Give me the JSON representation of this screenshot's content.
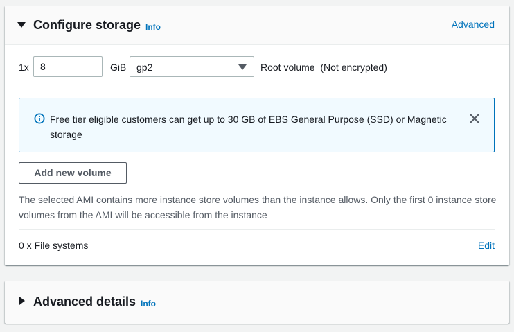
{
  "configure_storage": {
    "title": "Configure storage",
    "info_label": "Info",
    "advanced_link": "Advanced",
    "volume": {
      "count_prefix": "1x",
      "size_value": "8",
      "size_unit": "GiB",
      "volume_type": "gp2",
      "description": "Root volume  (Not encrypted)"
    },
    "alert": {
      "message": "Free tier eligible customers can get up to 30 GB of EBS General Purpose (SSD) or Magnetic storage",
      "icon": "info-circle-icon",
      "close_icon": "close-icon"
    },
    "add_volume_button": "Add new volume",
    "instance_store_warning": "The selected AMI contains more instance store volumes than the instance allows. Only the first 0 instance store volumes from the AMI will be accessible from the instance",
    "file_systems_label": "0 x File systems",
    "edit_link": "Edit"
  },
  "advanced_details": {
    "title": "Advanced details",
    "info_label": "Info"
  },
  "colors": {
    "link": "#0073bb",
    "alert_border": "#0073bb",
    "alert_background": "#f1faff",
    "text": "#16191f",
    "secondary_text": "#545b64"
  }
}
